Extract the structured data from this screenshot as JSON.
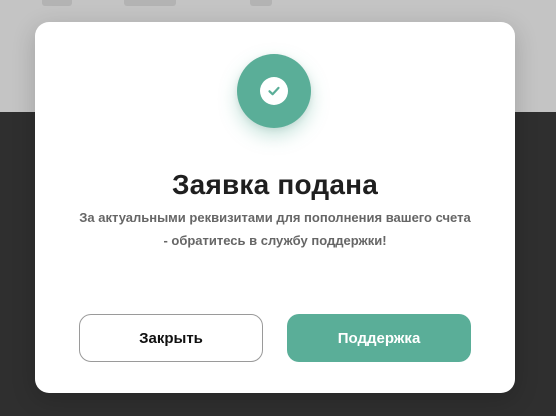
{
  "modal": {
    "title": "Заявка подана",
    "message_line1": "За актуальными реквизитами для пополнения вашего счета",
    "message_line2": "- обратитесь в службу поддержки!",
    "close_label": "Закрыть",
    "support_label": "Поддержка",
    "status_icon": "check-circle-icon"
  },
  "colors": {
    "accent": "#5aae98",
    "title": "#1f1f1f",
    "message": "#666666",
    "overlay_dark": "#2f2f2f",
    "overlay_light": "#c4c4c4"
  }
}
